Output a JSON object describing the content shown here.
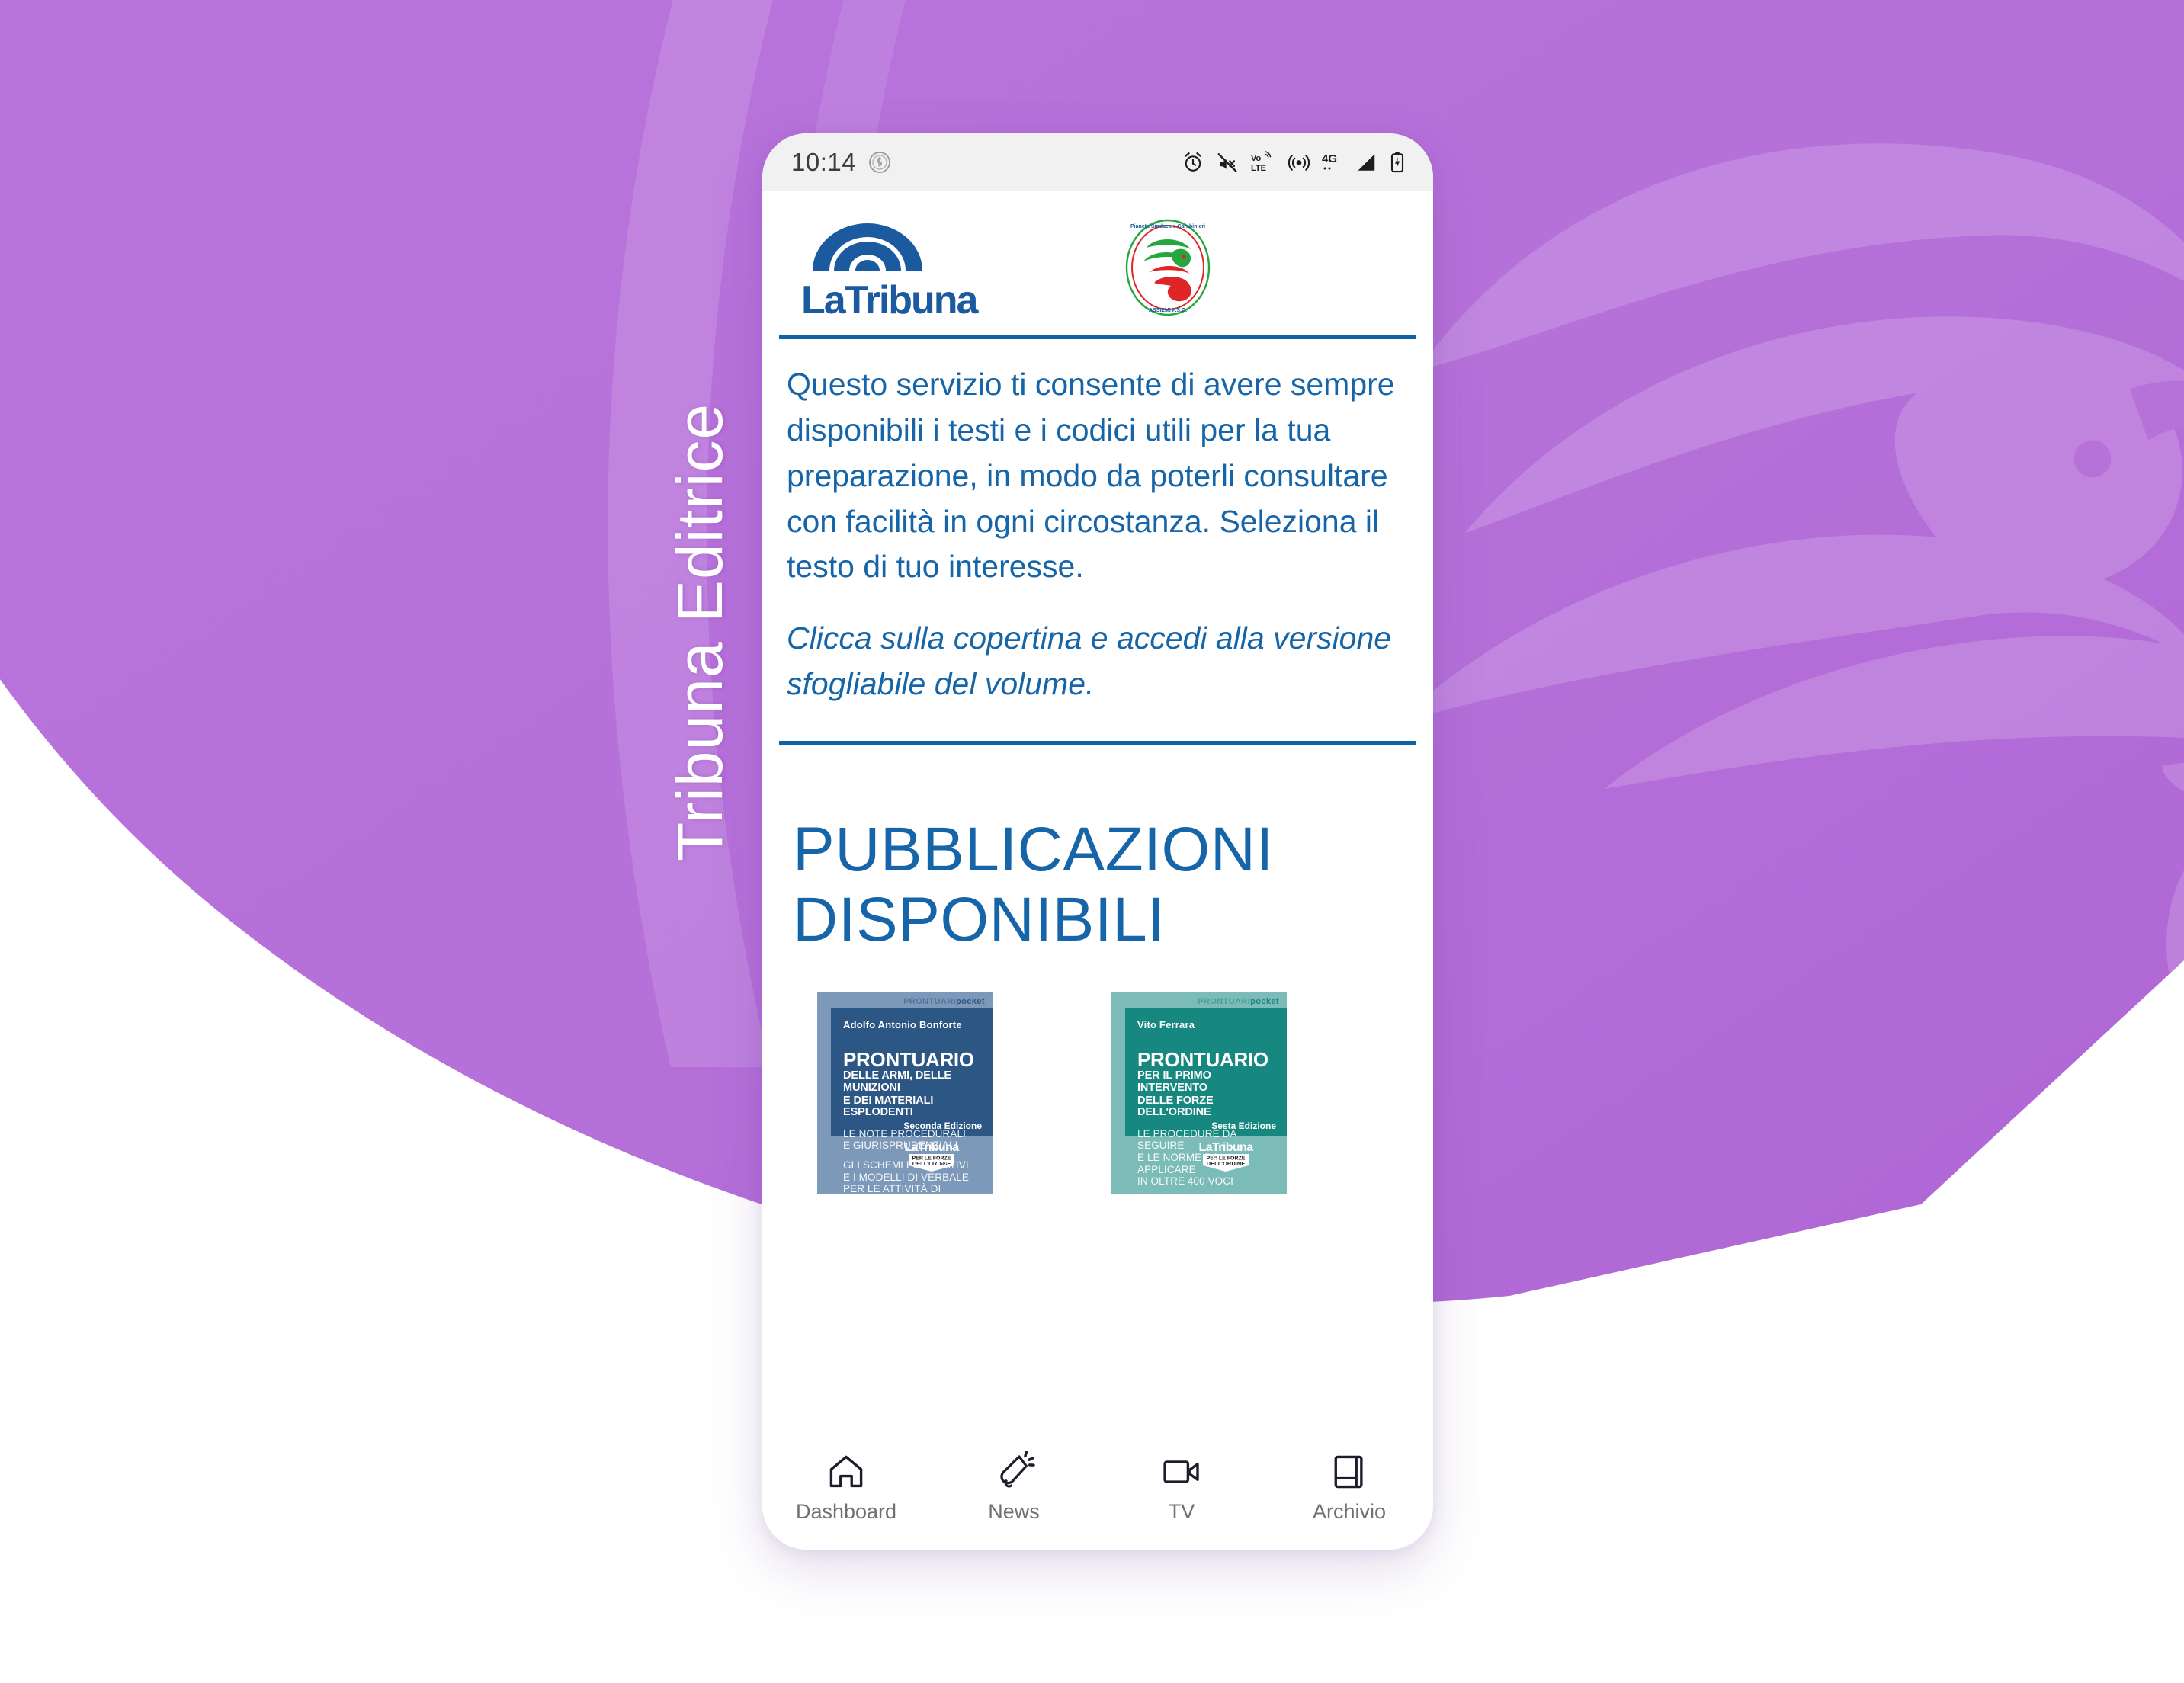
{
  "background": {
    "brand_vertical_text": "Tribuna Editrice",
    "purple": "#b972dd",
    "purple_light": "#c88ce4",
    "purple_dark": "#ad63d4"
  },
  "status_bar": {
    "time": "10:14",
    "app_icon": "app-notification-icon",
    "icons": [
      "alarm-icon",
      "ringer-muted-icon",
      "volte-icon",
      "hotspot-icon",
      "network-4g-icon",
      "signal-bars-icon",
      "battery-icon"
    ],
    "volte_label_top": "Vo",
    "volte_label_bottom": "LTE",
    "network_label": "4G"
  },
  "header": {
    "logo_primary": {
      "name": "latribuna-logo",
      "text_a": "La",
      "text_b": "Tribuna",
      "color": "#1b5a9e"
    },
    "logo_secondary": {
      "name": "pianeta-sindacale-carabinieri-logo",
      "ring_text": "Pianeta Sindacale Carabinieri",
      "bottom_text": "ASSIEMI  P.S.C.",
      "green": "#25a63f",
      "red": "#e02527"
    }
  },
  "intro": {
    "paragraph": "Questo servizio ti consente di avere sempre disponibili i testi e i codici utili per la tua preparazione, in modo da poterli consultare con facilità in ogni circostanza. Seleziona il testo di tuo interesse.",
    "note": "Clicca sulla copertina e accedi alla versione sfogliabile del volume.",
    "text_color": "#1565a8",
    "divider_color": "#0c63a6"
  },
  "section": {
    "title_line1": "PUBBLICAZIONI",
    "title_line2": "DISPONIBILI"
  },
  "books": [
    {
      "author": "Adolfo Antonio Bonforte",
      "pocket_label_a": "PRONTUARI",
      "pocket_label_b": "pocket",
      "title": "PRONTUARIO",
      "subtitle_line1": "DELLE ARMI, DELLE MUNIZIONI",
      "subtitle_line2": "E DEI MATERIALI ESPLODENTI",
      "desc_block1_line1": "LE NOTE PROCEDURALI",
      "desc_block1_line2": "E GIURISPRUDENZIALI",
      "desc_block2_line1": "GLI SCHEMI ESPLICATIVI",
      "desc_block2_line2": "E I MODELLI DI VERBALE",
      "desc_block2_line3": "PER LE ATTIVITÀ DI POLIZIA",
      "edition": "Seconda Edizione",
      "publisher": "LaTribuna",
      "badge_line1": "PER LE FORZE",
      "badge_line2": "DELL'ORDINE",
      "color_base": "#7c99ba",
      "color_top": "#2c5785"
    },
    {
      "author": "Vito Ferrara",
      "pocket_label_a": "PRONTUARI",
      "pocket_label_b": "pocket",
      "title": "PRONTUARIO",
      "subtitle_line1": "PER IL PRIMO INTERVENTO",
      "subtitle_line2": "DELLE FORZE DELL'ORDINE",
      "desc_block1_line1": "LE PROCEDURE DA SEGUIRE",
      "desc_block1_line2": "E LE NORME DA APPLICARE",
      "desc_block1_line3": "IN OLTRE 400 VOCI",
      "edition": "Sesta Edizione",
      "publisher": "LaTribuna",
      "badge_line1": "PER LE FORZE",
      "badge_line2": "DELL'ORDINE",
      "color_base": "#7bbcb8",
      "color_top": "#17887f"
    }
  ],
  "bottom_nav": {
    "items": [
      {
        "label": "Dashboard",
        "icon": "home-icon"
      },
      {
        "label": "News",
        "icon": "megaphone-icon"
      },
      {
        "label": "TV",
        "icon": "video-camera-icon"
      },
      {
        "label": "Archivio",
        "icon": "book-icon"
      }
    ]
  }
}
